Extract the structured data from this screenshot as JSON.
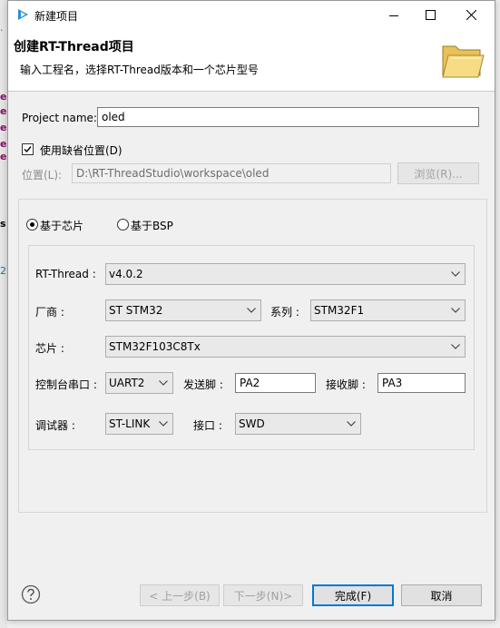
{
  "window": {
    "title": "新建项目",
    "minimize_glyph": "minimize-icon",
    "maximize_glyph": "maximize-icon",
    "close_glyph": "close-icon"
  },
  "header": {
    "title": "创建RT-Thread项目",
    "description": "输入工程名，选择RT-Thread版本和一个芯片型号"
  },
  "project": {
    "name_label": "Project name:",
    "name_value": "oled",
    "use_default_label": "使用缺省位置(D)",
    "use_default_checked": true,
    "location_label": "位置(L):",
    "location_value": "D:\\RT-ThreadStudio\\workspace\\oled",
    "browse_label": "浏览(R)..."
  },
  "mode": {
    "chip_label": "基于芯片",
    "bsp_label": "基于BSP",
    "selected": "chip"
  },
  "config": {
    "rtthread_label": "RT-Thread :",
    "rtthread_value": "v4.0.2",
    "vendor_label": "厂商 :",
    "vendor_value": "ST STM32",
    "series_label": "系列 :",
    "series_value": "STM32F1",
    "chip_label": "芯片 :",
    "chip_value": "STM32F103C8Tx",
    "console_label": "控制台串口 :",
    "console_value": "UART2",
    "tx_label": "发送脚 :",
    "tx_value": "PA2",
    "rx_label": "接收脚 :",
    "rx_value": "PA3",
    "debugger_label": "调试器 :",
    "debugger_value": "ST-LINK",
    "interface_label": "接口 :",
    "interface_value": "SWD"
  },
  "buttons": {
    "back": "< 上一步(B)",
    "next": "下一步(N)>",
    "finish": "完成(F)",
    "cancel": "取消"
  },
  "colors": {
    "accent": "#0078d7",
    "dialog_bg": "#f0f0f0",
    "header_bg": "#ffffff"
  }
}
